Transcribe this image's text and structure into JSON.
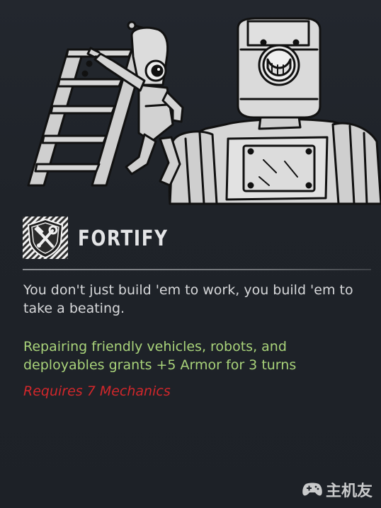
{
  "perk": {
    "title": "FORTIFY",
    "flavor_text": "You don't just build 'em to work, you build 'em to take a beating.",
    "effect_text": "Repairing friendly vehicles, robots, and deployables grants +5 Armor for 3 turns",
    "requirement_text": "Requires 7 Mechanics",
    "icon": "shield-wrench-hammer-icon",
    "illustration": "mechanic-ladder-robot-illustration"
  },
  "watermark": {
    "text": "主机友",
    "icon": "gamepad-icon"
  },
  "colors": {
    "background": "#1f2329",
    "title": "#e4e5e7",
    "flavor": "#d7d8da",
    "effect": "#a9d37a",
    "requirement": "#d2272b",
    "illustration_fill": "#d9d9d9"
  }
}
